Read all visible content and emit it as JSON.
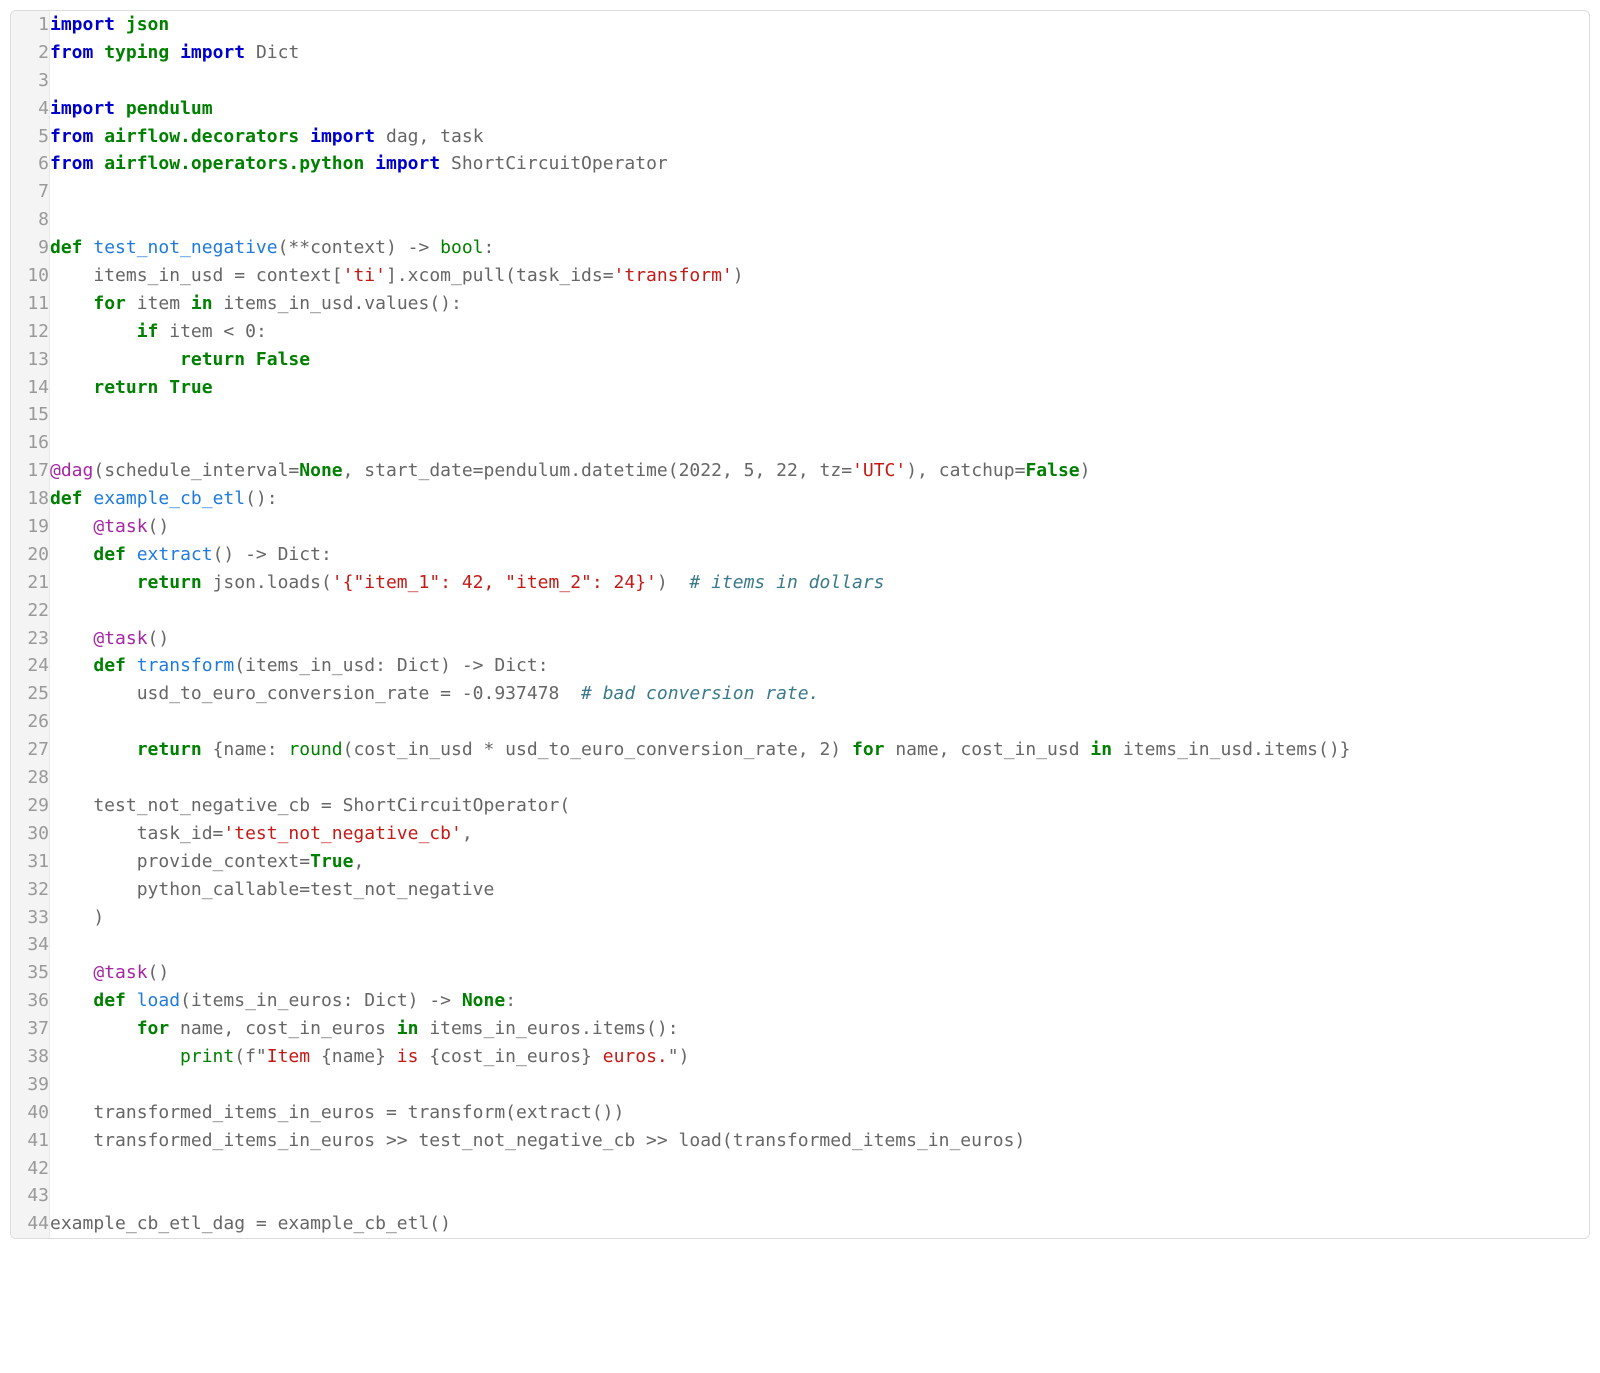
{
  "code": {
    "lines": [
      {
        "n": 1,
        "tokens": [
          [
            "kw-blue",
            "import"
          ],
          [
            "plain",
            " "
          ],
          [
            "kw-green",
            "json"
          ]
        ]
      },
      {
        "n": 2,
        "tokens": [
          [
            "kw-blue",
            "from"
          ],
          [
            "plain",
            " "
          ],
          [
            "kw-green",
            "typing"
          ],
          [
            "plain",
            " "
          ],
          [
            "kw-blue",
            "import"
          ],
          [
            "plain",
            " Dict"
          ]
        ]
      },
      {
        "n": 3,
        "tokens": [
          [
            "plain",
            ""
          ]
        ]
      },
      {
        "n": 4,
        "tokens": [
          [
            "kw-blue",
            "import"
          ],
          [
            "plain",
            " "
          ],
          [
            "kw-green",
            "pendulum"
          ]
        ]
      },
      {
        "n": 5,
        "tokens": [
          [
            "kw-blue",
            "from"
          ],
          [
            "plain",
            " "
          ],
          [
            "kw-green",
            "airflow.decorators"
          ],
          [
            "plain",
            " "
          ],
          [
            "kw-blue",
            "import"
          ],
          [
            "plain",
            " dag, task"
          ]
        ]
      },
      {
        "n": 6,
        "tokens": [
          [
            "kw-blue",
            "from"
          ],
          [
            "plain",
            " "
          ],
          [
            "kw-green",
            "airflow.operators.python"
          ],
          [
            "plain",
            " "
          ],
          [
            "kw-blue",
            "import"
          ],
          [
            "plain",
            " ShortCircuitOperator"
          ]
        ]
      },
      {
        "n": 7,
        "tokens": [
          [
            "plain",
            ""
          ]
        ]
      },
      {
        "n": 8,
        "tokens": [
          [
            "plain",
            ""
          ]
        ]
      },
      {
        "n": 9,
        "tokens": [
          [
            "kw-green",
            "def"
          ],
          [
            "plain",
            " "
          ],
          [
            "fname",
            "test_not_negative"
          ],
          [
            "plain",
            "(**context) -> "
          ],
          [
            "lit-green",
            "bool"
          ],
          [
            "plain",
            ":"
          ]
        ]
      },
      {
        "n": 10,
        "tokens": [
          [
            "plain",
            "    items_in_usd = context["
          ],
          [
            "str",
            "'ti'"
          ],
          [
            "plain",
            "].xcom_pull(task_ids="
          ],
          [
            "str",
            "'transform'"
          ],
          [
            "plain",
            ")"
          ]
        ]
      },
      {
        "n": 11,
        "tokens": [
          [
            "plain",
            "    "
          ],
          [
            "kw-green",
            "for"
          ],
          [
            "plain",
            " item "
          ],
          [
            "kw-green",
            "in"
          ],
          [
            "plain",
            " items_in_usd.values():"
          ]
        ]
      },
      {
        "n": 12,
        "tokens": [
          [
            "plain",
            "        "
          ],
          [
            "kw-green",
            "if"
          ],
          [
            "plain",
            " item < "
          ],
          [
            "num",
            "0"
          ],
          [
            "plain",
            ":"
          ]
        ]
      },
      {
        "n": 13,
        "tokens": [
          [
            "plain",
            "            "
          ],
          [
            "kw-green",
            "return"
          ],
          [
            "plain",
            " "
          ],
          [
            "kw-green",
            "False"
          ]
        ]
      },
      {
        "n": 14,
        "tokens": [
          [
            "plain",
            "    "
          ],
          [
            "kw-green",
            "return"
          ],
          [
            "plain",
            " "
          ],
          [
            "kw-green",
            "True"
          ]
        ]
      },
      {
        "n": 15,
        "tokens": [
          [
            "plain",
            ""
          ]
        ]
      },
      {
        "n": 16,
        "tokens": [
          [
            "plain",
            ""
          ]
        ]
      },
      {
        "n": 17,
        "tokens": [
          [
            "decor",
            "@dag"
          ],
          [
            "plain",
            "(schedule_interval="
          ],
          [
            "kw-green",
            "None"
          ],
          [
            "plain",
            ", start_date=pendulum.datetime("
          ],
          [
            "num",
            "2022"
          ],
          [
            "plain",
            ", "
          ],
          [
            "num",
            "5"
          ],
          [
            "plain",
            ", "
          ],
          [
            "num",
            "22"
          ],
          [
            "plain",
            ", tz="
          ],
          [
            "str",
            "'UTC'"
          ],
          [
            "plain",
            "), catchup="
          ],
          [
            "kw-green",
            "False"
          ],
          [
            "plain",
            ")"
          ]
        ]
      },
      {
        "n": 18,
        "tokens": [
          [
            "kw-green",
            "def"
          ],
          [
            "plain",
            " "
          ],
          [
            "fname",
            "example_cb_etl"
          ],
          [
            "plain",
            "():"
          ]
        ]
      },
      {
        "n": 19,
        "tokens": [
          [
            "plain",
            "    "
          ],
          [
            "decor",
            "@task"
          ],
          [
            "plain",
            "()"
          ]
        ]
      },
      {
        "n": 20,
        "tokens": [
          [
            "plain",
            "    "
          ],
          [
            "kw-green",
            "def"
          ],
          [
            "plain",
            " "
          ],
          [
            "fname",
            "extract"
          ],
          [
            "plain",
            "() -> Dict:"
          ]
        ]
      },
      {
        "n": 21,
        "tokens": [
          [
            "plain",
            "        "
          ],
          [
            "kw-green",
            "return"
          ],
          [
            "plain",
            " json.loads("
          ],
          [
            "str",
            "'{\"item_1\": 42, \"item_2\": 24}'"
          ],
          [
            "plain",
            ")  "
          ],
          [
            "cmt",
            "# items in dollars"
          ]
        ]
      },
      {
        "n": 22,
        "tokens": [
          [
            "plain",
            ""
          ]
        ]
      },
      {
        "n": 23,
        "tokens": [
          [
            "plain",
            "    "
          ],
          [
            "decor",
            "@task"
          ],
          [
            "plain",
            "()"
          ]
        ]
      },
      {
        "n": 24,
        "tokens": [
          [
            "plain",
            "    "
          ],
          [
            "kw-green",
            "def"
          ],
          [
            "plain",
            " "
          ],
          [
            "fname",
            "transform"
          ],
          [
            "plain",
            "(items_in_usd: Dict) -> Dict:"
          ]
        ]
      },
      {
        "n": 25,
        "tokens": [
          [
            "plain",
            "        usd_to_euro_conversion_rate = -"
          ],
          [
            "num",
            "0.937478"
          ],
          [
            "plain",
            "  "
          ],
          [
            "cmt",
            "# bad conversion rate."
          ]
        ]
      },
      {
        "n": 26,
        "tokens": [
          [
            "plain",
            ""
          ]
        ]
      },
      {
        "n": 27,
        "tokens": [
          [
            "plain",
            "        "
          ],
          [
            "kw-green",
            "return"
          ],
          [
            "plain",
            " {name: "
          ],
          [
            "lit-green",
            "round"
          ],
          [
            "plain",
            "(cost_in_usd * usd_to_euro_conversion_rate, "
          ],
          [
            "num",
            "2"
          ],
          [
            "plain",
            ") "
          ],
          [
            "kw-green",
            "for"
          ],
          [
            "plain",
            " name, cost_in_usd "
          ],
          [
            "kw-green",
            "in"
          ],
          [
            "plain",
            " items_in_usd.items()}"
          ]
        ]
      },
      {
        "n": 28,
        "tokens": [
          [
            "plain",
            ""
          ]
        ]
      },
      {
        "n": 29,
        "tokens": [
          [
            "plain",
            "    test_not_negative_cb = ShortCircuitOperator("
          ]
        ]
      },
      {
        "n": 30,
        "tokens": [
          [
            "plain",
            "        task_id="
          ],
          [
            "str",
            "'test_not_negative_cb'"
          ],
          [
            "plain",
            ","
          ]
        ]
      },
      {
        "n": 31,
        "tokens": [
          [
            "plain",
            "        provide_context="
          ],
          [
            "kw-green",
            "True"
          ],
          [
            "plain",
            ","
          ]
        ]
      },
      {
        "n": 32,
        "tokens": [
          [
            "plain",
            "        python_callable=test_not_negative"
          ]
        ]
      },
      {
        "n": 33,
        "tokens": [
          [
            "plain",
            "    )"
          ]
        ]
      },
      {
        "n": 34,
        "tokens": [
          [
            "plain",
            ""
          ]
        ]
      },
      {
        "n": 35,
        "tokens": [
          [
            "plain",
            "    "
          ],
          [
            "decor",
            "@task"
          ],
          [
            "plain",
            "()"
          ]
        ]
      },
      {
        "n": 36,
        "tokens": [
          [
            "plain",
            "    "
          ],
          [
            "kw-green",
            "def"
          ],
          [
            "plain",
            " "
          ],
          [
            "fname",
            "load"
          ],
          [
            "plain",
            "(items_in_euros: Dict) -> "
          ],
          [
            "kw-green",
            "None"
          ],
          [
            "plain",
            ":"
          ]
        ]
      },
      {
        "n": 37,
        "tokens": [
          [
            "plain",
            "        "
          ],
          [
            "kw-green",
            "for"
          ],
          [
            "plain",
            " name, cost_in_euros "
          ],
          [
            "kw-green",
            "in"
          ],
          [
            "plain",
            " items_in_euros.items():"
          ]
        ]
      },
      {
        "n": 38,
        "tokens": [
          [
            "plain",
            "            "
          ],
          [
            "lit-green",
            "print"
          ],
          [
            "plain",
            "(f\""
          ],
          [
            "str",
            "Item "
          ],
          [
            "plain",
            "{name}"
          ],
          [
            "str",
            " is "
          ],
          [
            "plain",
            "{cost_in_euros}"
          ],
          [
            "str",
            " euros."
          ],
          [
            "plain",
            "\")"
          ]
        ]
      },
      {
        "n": 39,
        "tokens": [
          [
            "plain",
            ""
          ]
        ]
      },
      {
        "n": 40,
        "tokens": [
          [
            "plain",
            "    transformed_items_in_euros = transform(extract())"
          ]
        ]
      },
      {
        "n": 41,
        "tokens": [
          [
            "plain",
            "    transformed_items_in_euros >> test_not_negative_cb >> load(transformed_items_in_euros)"
          ]
        ]
      },
      {
        "n": 42,
        "tokens": [
          [
            "plain",
            ""
          ]
        ]
      },
      {
        "n": 43,
        "tokens": [
          [
            "plain",
            ""
          ]
        ]
      },
      {
        "n": 44,
        "tokens": [
          [
            "plain",
            "example_cb_etl_dag = example_cb_etl()"
          ]
        ]
      }
    ]
  }
}
